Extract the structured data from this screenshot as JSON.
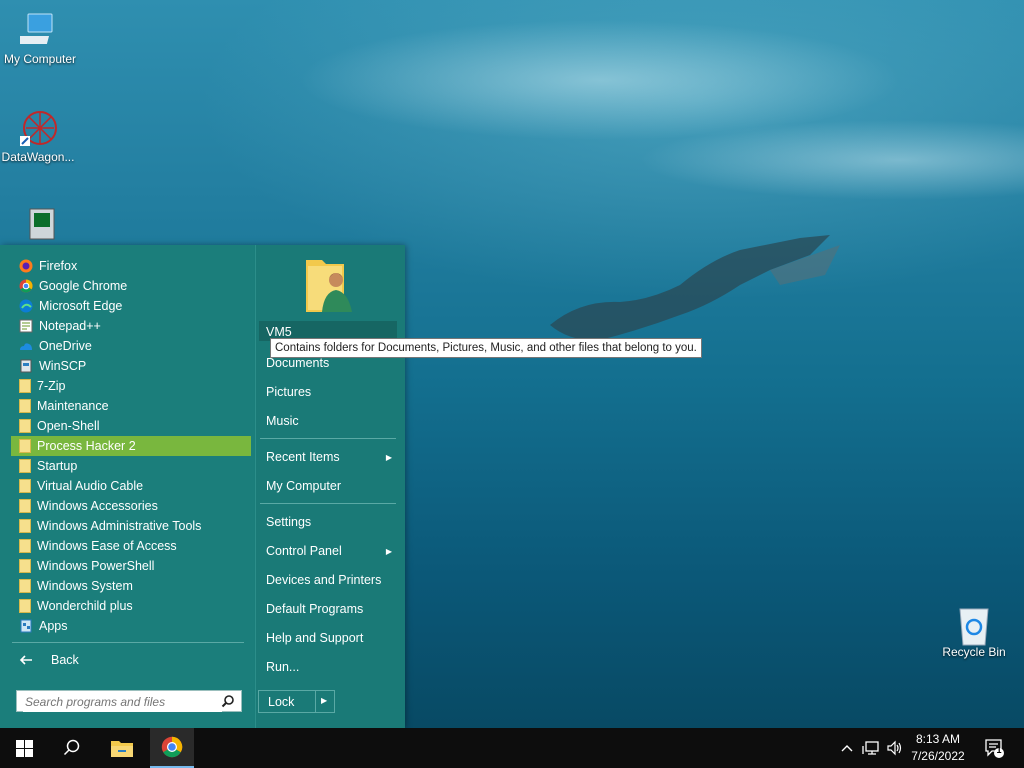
{
  "desktop": {
    "icons": [
      {
        "label": "My Computer",
        "icon": "computer-icon"
      },
      {
        "label": "DataWagon...",
        "icon": "datawagon-icon"
      },
      {
        "label": "",
        "icon": "monitor-app-icon"
      },
      {
        "label": "Recycle Bin",
        "icon": "recycle-bin-icon"
      }
    ]
  },
  "start_menu": {
    "programs": [
      {
        "label": "Firefox",
        "icon": "firefox-icon"
      },
      {
        "label": "Google Chrome",
        "icon": "chrome-icon"
      },
      {
        "label": "Microsoft Edge",
        "icon": "edge-icon"
      },
      {
        "label": "Notepad++",
        "icon": "notepadpp-icon"
      },
      {
        "label": "OneDrive",
        "icon": "onedrive-icon"
      },
      {
        "label": "WinSCP",
        "icon": "winscp-icon"
      },
      {
        "label": "7-Zip",
        "icon": "folder-icon"
      },
      {
        "label": "Maintenance",
        "icon": "folder-icon"
      },
      {
        "label": "Open-Shell",
        "icon": "folder-icon"
      },
      {
        "label": "Process Hacker 2",
        "icon": "folder-icon"
      },
      {
        "label": "Startup",
        "icon": "folder-icon"
      },
      {
        "label": "Virtual Audio Cable",
        "icon": "folder-icon"
      },
      {
        "label": "Windows Accessories",
        "icon": "folder-icon"
      },
      {
        "label": "Windows Administrative Tools",
        "icon": "folder-icon"
      },
      {
        "label": "Windows Ease of Access",
        "icon": "folder-icon"
      },
      {
        "label": "Windows PowerShell",
        "icon": "folder-icon"
      },
      {
        "label": "Windows System",
        "icon": "folder-icon"
      },
      {
        "label": "Wonderchild plus",
        "icon": "folder-icon"
      },
      {
        "label": "Apps",
        "icon": "apps-icon"
      }
    ],
    "selected_program": "Process Hacker 2",
    "back_label": "Back",
    "search_placeholder": "Search programs and files",
    "user_name": "VM5",
    "tooltip": "Contains folders for Documents, Pictures, Music, and other files that belong to you.",
    "right_items": {
      "documents": "Documents",
      "pictures": "Pictures",
      "music": "Music",
      "recent_items": "Recent Items",
      "my_computer": "My Computer",
      "settings": "Settings",
      "control_panel": "Control Panel",
      "devices_printers": "Devices and Printers",
      "default_programs": "Default Programs",
      "help_support": "Help and Support",
      "run": "Run..."
    },
    "lock_label": "Lock",
    "accent_color": "#79b73e",
    "menu_color": "#1b7e7b"
  },
  "taskbar": {
    "time": "8:13 AM",
    "date": "7/26/2022",
    "notification_count": "1"
  }
}
